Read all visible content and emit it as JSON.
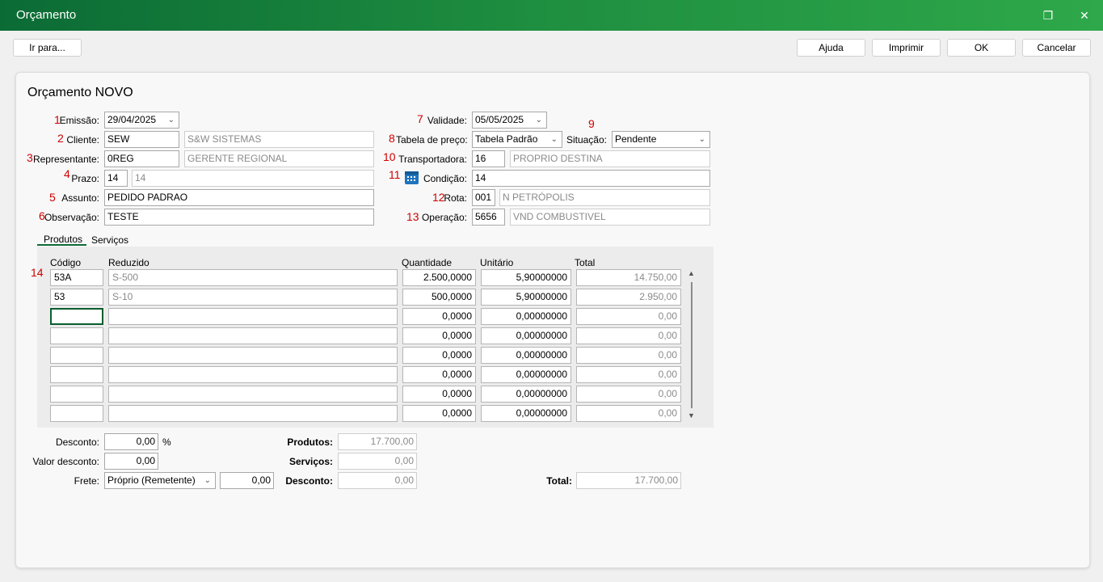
{
  "window": {
    "title": "Orçamento",
    "restore_icon": "restore-icon",
    "close_icon": "close-icon"
  },
  "toolbar": {
    "goto": "Ir para...",
    "help": "Ajuda",
    "print": "Imprimir",
    "ok": "OK",
    "cancel": "Cancelar"
  },
  "form": {
    "heading": "Orçamento NOVO",
    "numbers": [
      "1",
      "2",
      "3",
      "4",
      "5",
      "6",
      "7",
      "8",
      "9",
      "10",
      "11",
      "12",
      "13",
      "14"
    ],
    "emissao": {
      "label": "Emissão:",
      "value": "29/04/2025"
    },
    "cliente": {
      "label": "Cliente:",
      "code": "SEW",
      "name": "S&W SISTEMAS"
    },
    "representante": {
      "label": "Representante:",
      "code": "0REG",
      "name": "GERENTE REGIONAL"
    },
    "prazo": {
      "label": "Prazo:",
      "code": "14",
      "desc": "14"
    },
    "assunto": {
      "label": "Assunto:",
      "value": "PEDIDO PADRAO"
    },
    "observacao": {
      "label": "Observação:",
      "value": "TESTE"
    },
    "validade": {
      "label": "Validade:",
      "value": "05/05/2025"
    },
    "tabela": {
      "label": "Tabela de preço:",
      "value": "Tabela Padrão"
    },
    "situacao": {
      "label": "Situação:",
      "value": "Pendente"
    },
    "transportadora": {
      "label": "Transportadora:",
      "code": "16",
      "name": "PROPRIO DESTINA"
    },
    "condicao": {
      "label": "Condição:",
      "value": "14",
      "icon": "calendar-icon"
    },
    "rota": {
      "label": "Rota:",
      "code": "001",
      "name": "N PETRÓPOLIS"
    },
    "operacao": {
      "label": "Operação:",
      "code": "5656",
      "name": "VND COMBUSTIVEL"
    }
  },
  "tabs": [
    "Produtos",
    "Serviços"
  ],
  "grid": {
    "headers": [
      "Código",
      "Reduzido",
      "Quantidade",
      "Unitário",
      "Total"
    ],
    "rows": [
      [
        "53A",
        "S-500",
        "2.500,0000",
        "5,90000000",
        "14.750,00"
      ],
      [
        "53",
        "S-10",
        "500,0000",
        "5,90000000",
        "2.950,00"
      ],
      [
        "",
        "",
        "0,0000",
        "0,00000000",
        "0,00"
      ],
      [
        "",
        "",
        "0,0000",
        "0,00000000",
        "0,00"
      ],
      [
        "",
        "",
        "0,0000",
        "0,00000000",
        "0,00"
      ],
      [
        "",
        "",
        "0,0000",
        "0,00000000",
        "0,00"
      ],
      [
        "",
        "",
        "0,0000",
        "0,00000000",
        "0,00"
      ],
      [
        "",
        "",
        "0,0000",
        "0,00000000",
        "0,00"
      ]
    ]
  },
  "footer": {
    "desconto": {
      "label": "Desconto:",
      "value": "0,00",
      "unit": "%"
    },
    "valor_desconto": {
      "label": "Valor desconto:",
      "value": "0,00"
    },
    "frete": {
      "label": "Frete:",
      "value": "Próprio (Remetente)",
      "amount": "0,00"
    },
    "produtos": {
      "label": "Produtos:",
      "value": "17.700,00"
    },
    "servicos": {
      "label": "Serviços:",
      "value": "0,00"
    },
    "desconto_total": {
      "label": "Desconto:",
      "value": "0,00"
    },
    "total": {
      "label": "Total:",
      "value": "17.700,00"
    }
  }
}
